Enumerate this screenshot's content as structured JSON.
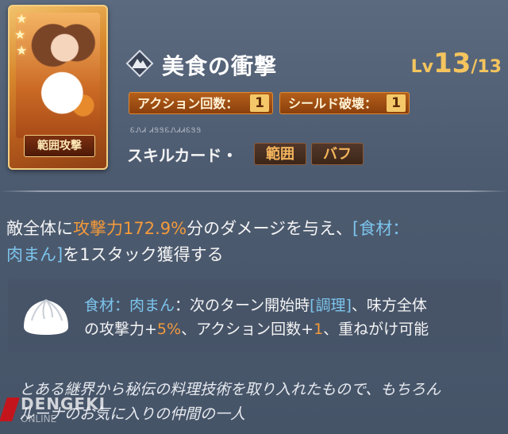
{
  "card": {
    "type_label": "範囲攻撃",
    "stars": [
      "★",
      "★",
      "★"
    ]
  },
  "skill": {
    "icon": "mountain-emblem-icon",
    "name": "美食の衝撃",
    "level_prefix": "Lv",
    "level_current": "13",
    "level_max": "/13"
  },
  "stats": [
    {
      "label": "アクション回数：",
      "value": "1"
    },
    {
      "label": "シールド破壊：",
      "value": "1"
    }
  ],
  "script_line": "ᏋᏁᏗ ᏗᏕᏕᏋᏁᏗᏗᏋᏕᏕ",
  "card_type": {
    "label": "スキルカード・",
    "chips": [
      "範囲",
      "バフ"
    ]
  },
  "description": {
    "part1": "敵全体に",
    "atk": "攻撃力172.9%",
    "part2": "分のダメージを与え、",
    "tag1": "[食材：",
    "tag2": "肉まん]",
    "part3": "を1スタック獲得する"
  },
  "detail": {
    "icon": "steamed-bun-icon",
    "title": "食材：肉まん",
    "t1": "：次のターン開始時",
    "tag": "[調理]",
    "t2": "、味方全体",
    "t3": "の攻撃力+",
    "pct": "5%",
    "t4": "、アクション回数+",
    "one": "1",
    "t5": "、重ねがけ可能"
  },
  "flavor": {
    "line1": "とある継界から秘伝の料理技術を取り入れたもので、もちろん",
    "line2": "ルーナのお気に入りの仲間の一人"
  },
  "watermark": {
    "line1": "DENGEKI",
    "line2": "ONLINE"
  },
  "colors": {
    "accent_orange": "#f39a3a",
    "accent_blue": "#7cc4ec",
    "level_gold": "#f4c45e"
  }
}
